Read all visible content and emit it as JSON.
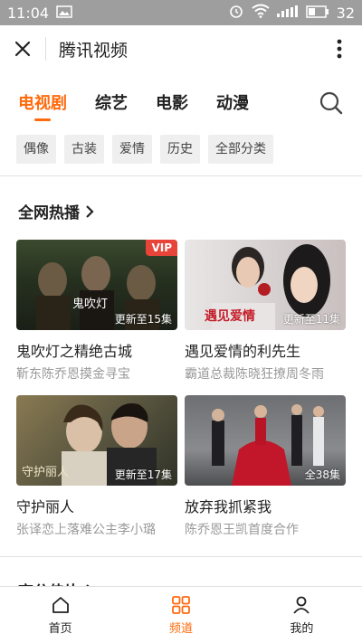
{
  "status": {
    "time": "11:04",
    "battery": "32"
  },
  "app": {
    "title": "腾讯视频"
  },
  "tabs": [
    {
      "label": "电视剧",
      "active": true
    },
    {
      "label": "综艺"
    },
    {
      "label": "电影"
    },
    {
      "label": "动漫"
    }
  ],
  "chips": [
    "偶像",
    "古装",
    "爱情",
    "历史",
    "全部分类"
  ],
  "section1": {
    "title": "全网热播"
  },
  "cards": [
    {
      "title": "鬼吹灯之精绝古城",
      "subtitle": "靳东陈乔恩摸金寻宝",
      "episode": "更新至15集",
      "vip": "VIP",
      "thumb_text": "鬼吹灯"
    },
    {
      "title": "遇见爱情的利先生",
      "subtitle": "霸道总裁陈晓狂撩周冬雨",
      "episode": "更新至11集",
      "thumb_text": "遇见爱情"
    },
    {
      "title": "守护丽人",
      "subtitle": "张译恋上落难公主李小璐",
      "episode": "更新至17集",
      "thumb_text": "守护丽人"
    },
    {
      "title": "放弃我抓紧我",
      "subtitle": "陈乔恩王凯首度合作",
      "episode": "全38集"
    }
  ],
  "section2": {
    "title": "高分佳片"
  },
  "bottom_nav": [
    {
      "label": "首页",
      "icon": "home-icon"
    },
    {
      "label": "频道",
      "icon": "grid-icon",
      "active": true
    },
    {
      "label": "我的",
      "icon": "user-icon"
    }
  ],
  "colors": {
    "accent": "#ff6a0c",
    "vip": "#e8443a",
    "status_bar": "#9e9e9e"
  }
}
